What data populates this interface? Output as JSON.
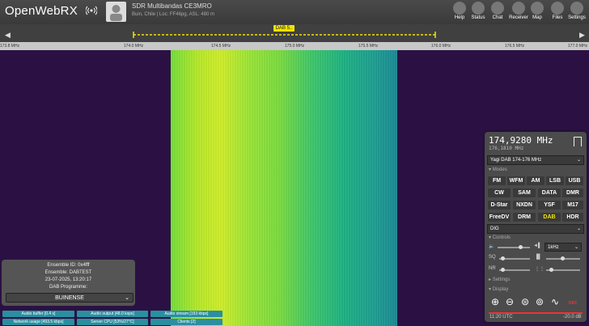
{
  "header": {
    "logo_text": "OpenWebRX",
    "receiver_title": "SDR Multibandas CE3MRO",
    "receiver_desc": "Buin, Chile | Loc: FF46pg, ASL: 480 m",
    "buttons": [
      {
        "label": "Help",
        "icon": "help-icon"
      },
      {
        "label": "Status",
        "icon": "status-icon"
      },
      {
        "label": "Chat",
        "icon": "chat-icon"
      },
      {
        "label": "Receiver",
        "icon": "receiver-icon"
      },
      {
        "label": "Map",
        "icon": "map-icon"
      },
      {
        "label": "Files",
        "icon": "files-icon"
      },
      {
        "label": "Settings",
        "icon": "settings-icon"
      }
    ]
  },
  "bandplan": {
    "label": "DAB 5..",
    "color": "#f2e300"
  },
  "scale": {
    "ticks": [
      "173.8 MHz",
      "174.0 MHz",
      "174.5 MHz",
      "175.0 MHz",
      "175.5 MHz",
      "176.0 MHz",
      "176.5 MHz",
      "177.0 MHz"
    ]
  },
  "receiver": {
    "frequency": "174,9280 MHz",
    "sub_frequency": "176,1810 MHz",
    "profile": "Yagi DAB 174-176 MHz",
    "modes_section": "Modes",
    "modes": [
      [
        "FM",
        "WFM",
        "AM",
        "LSB",
        "USB"
      ],
      [
        "CW",
        "SAM",
        "DATA",
        "DMR"
      ],
      [
        "D-Star",
        "NXDN",
        "YSF",
        "M17"
      ],
      [
        "FreeDV",
        "DRM",
        "DAB",
        "HDR"
      ]
    ],
    "active_mode": "DAB",
    "decoder_select": "DIG",
    "controls_section": "Controls",
    "step_select": "1kHz",
    "settings_section": "Settings",
    "display_section": "Display",
    "rec_label": "REC",
    "clock": "11:20 UTC",
    "db_level": "-20.0 dB"
  },
  "dab": {
    "ensemble_id": "Ensemble ID: 0x4fff",
    "ensemble": "Ensemble: DABTEST",
    "datetime": "23-07-2025, 13:20:17",
    "programme_label": "DAB Programme:",
    "programme_selected": "BUINENSE"
  },
  "status": {
    "audio_buffer": "Audio buffer [0.4 s]",
    "audio_output": "Audio output [48.0 ksps]",
    "audio_stream": "Audio stream [193 kbps]",
    "network_usage": "Network usage [493.5 kbps]",
    "server_cpu": "Server CPU [53%/27°C]",
    "clients": "Clients [2]",
    "accent": "#2a8fa0"
  }
}
